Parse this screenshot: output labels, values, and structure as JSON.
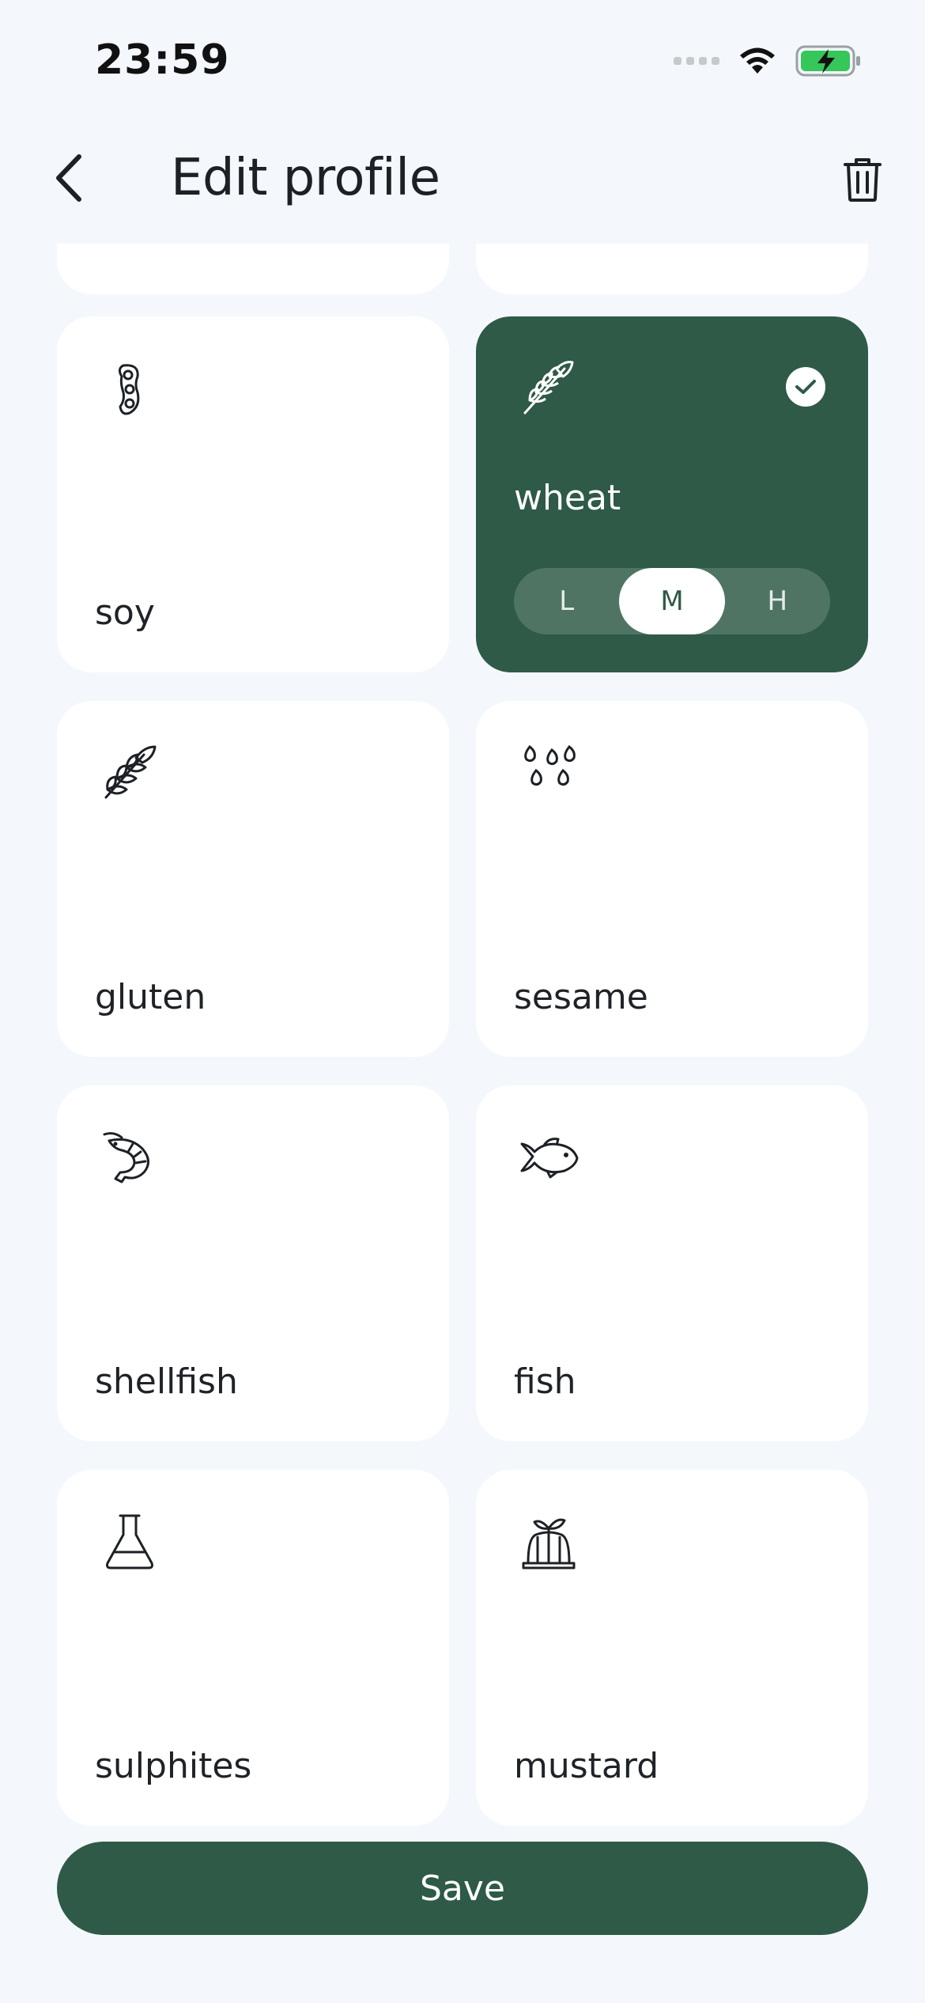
{
  "status_bar": {
    "time": "23:59"
  },
  "header": {
    "title": "Edit profile"
  },
  "allergens": [
    {
      "label": "soy",
      "icon": "soybean-icon",
      "selected": false
    },
    {
      "label": "wheat",
      "icon": "wheat-icon",
      "selected": true,
      "levels": [
        "L",
        "M",
        "H"
      ],
      "active_level": "M"
    },
    {
      "label": "gluten",
      "icon": "grain-icon",
      "selected": false
    },
    {
      "label": "sesame",
      "icon": "seeds-icon",
      "selected": false
    },
    {
      "label": "shellfish",
      "icon": "shrimp-icon",
      "selected": false
    },
    {
      "label": "fish",
      "icon": "fish-icon",
      "selected": false
    },
    {
      "label": "sulphites",
      "icon": "flask-icon",
      "selected": false
    },
    {
      "label": "mustard",
      "icon": "jelly-icon",
      "selected": false
    }
  ],
  "save_label": "Save",
  "colors": {
    "accent": "#2e5a47",
    "background": "#f4f8fd",
    "card": "#ffffff"
  }
}
